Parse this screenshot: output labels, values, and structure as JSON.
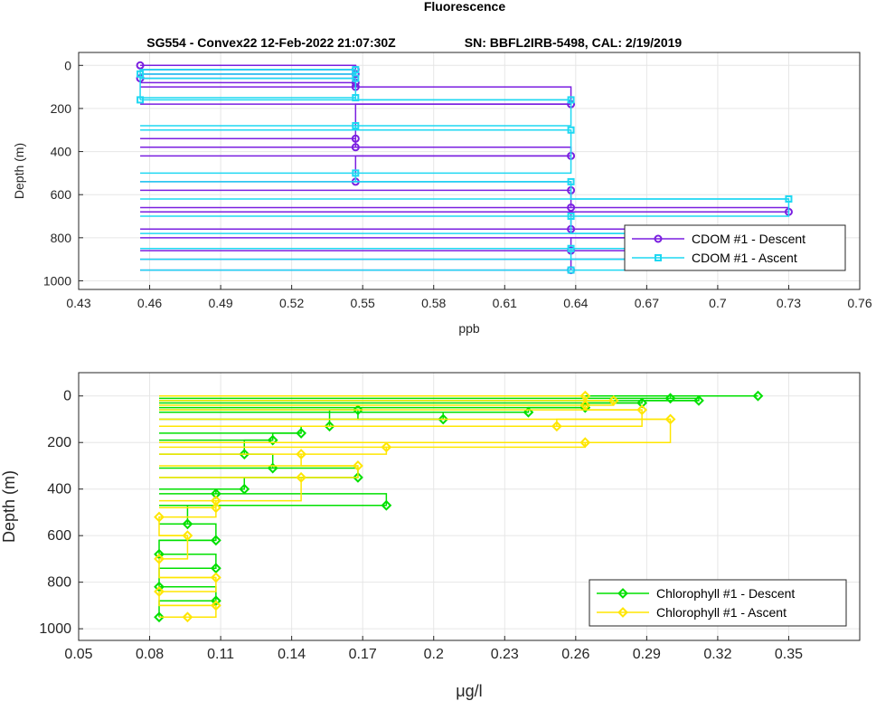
{
  "figure": {
    "suptitle": "Fluorescence",
    "subtitle_left": "SG554 - Convex22 12-Feb-2022 21:07:30Z",
    "subtitle_right": "SN: BBFL2IRB-5498, CAL: 2/19/2019"
  },
  "chart_data": [
    {
      "type": "line",
      "xlabel": "ppb",
      "ylabel": "Depth (m)",
      "xlim": [
        0.43,
        0.76
      ],
      "ylim": [
        1040,
        -60
      ],
      "y_reversed": true,
      "grid": true,
      "xticks": [
        0.43,
        0.46,
        0.49,
        0.52,
        0.55,
        0.58,
        0.61,
        0.64,
        0.67,
        0.7,
        0.73,
        0.76
      ],
      "xtick_labels": [
        "0.43",
        "0.46",
        "0.49",
        "0.52",
        "0.55",
        "0.58",
        "0.61",
        "0.64",
        "0.67",
        "0.7",
        "0.73",
        "0.76"
      ],
      "yticks": [
        0,
        200,
        400,
        600,
        800,
        1000
      ],
      "ytick_labels": [
        "0",
        "200",
        "400",
        "600",
        "800",
        "1000"
      ],
      "legend_position": "lower-right",
      "series": [
        {
          "name": "CDOM #1 - Descent",
          "color": "#7a1fe0",
          "marker": "circle",
          "x": [
            0.456,
            0.547,
            0.547,
            0.456,
            0.547,
            0.547,
            0.638,
            0.547,
            0.547,
            0.638,
            0.547,
            0.638,
            0.638,
            0.73,
            0.638,
            0.73,
            0.638,
            0.73,
            0.638
          ],
          "y": [
            0,
            20,
            40,
            60,
            80,
            100,
            180,
            340,
            380,
            420,
            540,
            580,
            660,
            680,
            760,
            800,
            860,
            900,
            950
          ]
        },
        {
          "name": "CDOM #1 - Ascent",
          "color": "#1fd8f2",
          "marker": "square",
          "x": [
            0.638,
            0.73,
            0.638,
            0.73,
            0.638,
            0.73,
            0.638,
            0.547,
            0.638,
            0.547,
            0.638,
            0.547,
            0.547,
            0.456,
            0.547,
            0.456
          ],
          "y": [
            950,
            900,
            850,
            780,
            700,
            620,
            540,
            500,
            300,
            280,
            160,
            150,
            60,
            40,
            20,
            160
          ]
        }
      ]
    },
    {
      "type": "line",
      "xlabel": "μg/l",
      "ylabel": "Depth (m)",
      "xlim": [
        0.05,
        0.38
      ],
      "ylim": [
        1050,
        -100
      ],
      "y_reversed": true,
      "grid": true,
      "xticks": [
        0.05,
        0.08,
        0.11,
        0.14,
        0.17,
        0.2,
        0.23,
        0.26,
        0.29,
        0.32,
        0.35
      ],
      "xtick_labels": [
        "0.05",
        "0.08",
        "0.11",
        "0.14",
        "0.17",
        "0.2",
        "0.23",
        "0.26",
        "0.29",
        "0.32",
        "0.35"
      ],
      "yticks": [
        0,
        200,
        400,
        600,
        800,
        1000
      ],
      "ytick_labels": [
        "0",
        "200",
        "400",
        "600",
        "800",
        "1000"
      ],
      "legend_position": "lower-right",
      "series": [
        {
          "name": "Chlorophyll #1 - Descent",
          "color": "#00e000",
          "marker": "diamond",
          "x": [
            0.337,
            0.3,
            0.312,
            0.288,
            0.264,
            0.24,
            0.204,
            0.168,
            0.156,
            0.144,
            0.132,
            0.12,
            0.132,
            0.168,
            0.12,
            0.108,
            0.18,
            0.096,
            0.108,
            0.084,
            0.108,
            0.084,
            0.108,
            0.084
          ],
          "y": [
            0,
            10,
            20,
            30,
            50,
            70,
            100,
            60,
            130,
            160,
            190,
            250,
            310,
            350,
            400,
            420,
            470,
            550,
            620,
            680,
            740,
            820,
            880,
            950
          ]
        },
        {
          "name": "Chlorophyll #1 - Ascent",
          "color": "#ffe600",
          "marker": "diamond",
          "x": [
            0.096,
            0.108,
            0.084,
            0.108,
            0.084,
            0.096,
            0.084,
            0.108,
            0.108,
            0.144,
            0.168,
            0.144,
            0.18,
            0.264,
            0.3,
            0.252,
            0.288,
            0.264,
            0.276,
            0.264
          ],
          "y": [
            950,
            900,
            840,
            780,
            700,
            600,
            520,
            480,
            450,
            350,
            300,
            250,
            220,
            200,
            100,
            130,
            60,
            40,
            20,
            0
          ]
        }
      ]
    }
  ]
}
